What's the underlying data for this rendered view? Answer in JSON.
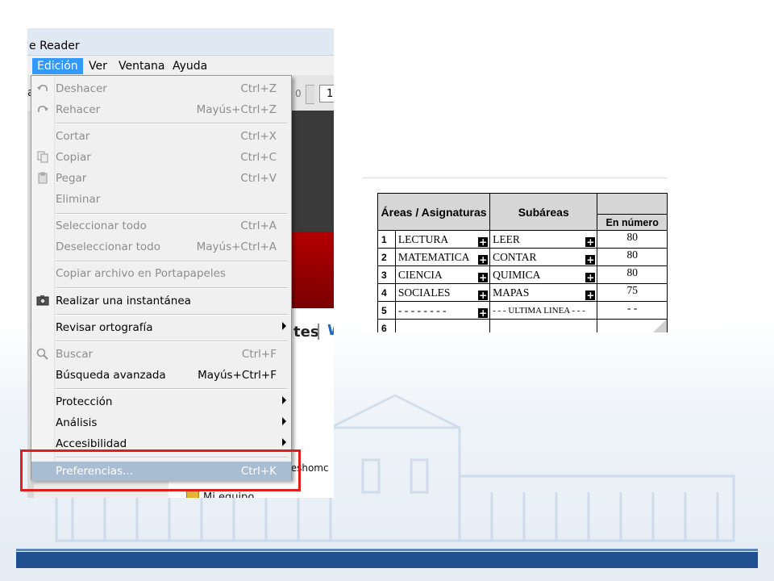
{
  "window": {
    "title": "e Reader"
  },
  "menubar": [
    {
      "label": "Edición",
      "active": true
    },
    {
      "label": "Ver",
      "active": false
    },
    {
      "label": "Ventana",
      "active": false
    },
    {
      "label": "Ayuda",
      "active": false
    }
  ],
  "toolbar": {
    "al_fragment": "al",
    "zero": "0",
    "page_field": "1"
  },
  "edit_menu": {
    "deshacer": {
      "label": "Deshacer",
      "shortcut": "Ctrl+Z"
    },
    "rehacer": {
      "label": "Rehacer",
      "shortcut": "Mayús+Ctrl+Z"
    },
    "cortar": {
      "label": "Cortar",
      "shortcut": "Ctrl+X"
    },
    "copiar": {
      "label": "Copiar",
      "shortcut": "Ctrl+C"
    },
    "pegar": {
      "label": "Pegar",
      "shortcut": "Ctrl+V"
    },
    "eliminar": {
      "label": "Eliminar"
    },
    "seleccionar_todo": {
      "label": "Seleccionar todo",
      "shortcut": "Ctrl+A"
    },
    "deseleccionar_todo": {
      "label": "Deseleccionar todo",
      "shortcut": "Mayús+Ctrl+A"
    },
    "copiar_archivo": {
      "label": "Copiar archivo en Portapapeles"
    },
    "instantanea": {
      "label": "Realizar una instantánea"
    },
    "ortografia": {
      "label": "Revisar ortografía"
    },
    "buscar": {
      "label": "Buscar",
      "shortcut": "Ctrl+F"
    },
    "busqueda_avanzada": {
      "label": "Búsqueda avanzada",
      "shortcut": "Mayús+Ctrl+F"
    },
    "proteccion": {
      "label": "Protección"
    },
    "analisis": {
      "label": "Análisis"
    },
    "accesibilidad": {
      "label": "Accesibilidad"
    },
    "preferencias": {
      "label": "Preferencias...",
      "shortcut": "Ctrl+K"
    }
  },
  "background_doc": {
    "tab_fragment": "tes",
    "tab_w": "W",
    "text_fragment": "teshomc",
    "folder_label": "Mi equipo"
  },
  "grades_table": {
    "headers": {
      "areas": "Áreas / Asignaturas",
      "subareas": "Subáreas",
      "numero": "En número"
    },
    "rows": [
      {
        "num": "1",
        "area": "LECTURA",
        "sub": "LEER",
        "val": "80"
      },
      {
        "num": "2",
        "area": "MATEMATICA",
        "sub": "CONTAR",
        "val": "80"
      },
      {
        "num": "3",
        "area": "CIENCIA",
        "sub": "QUIMICA",
        "val": "80"
      },
      {
        "num": "4",
        "area": "SOCIALES",
        "sub": "MAPAS",
        "val": "75"
      },
      {
        "num": "5",
        "area": "- - - - - - - -",
        "sub": "- - - ULTIMA LINEA - - -",
        "val": "- -"
      },
      {
        "num": "6",
        "area": "",
        "sub": "",
        "val": ""
      }
    ],
    "plus_glyph": "+"
  },
  "colors": {
    "menu_highlight": "#3399ff",
    "selected_item": "#a9bdd2",
    "callout_frame": "#e01e1e",
    "footer_bar": "#1f4f8f"
  }
}
